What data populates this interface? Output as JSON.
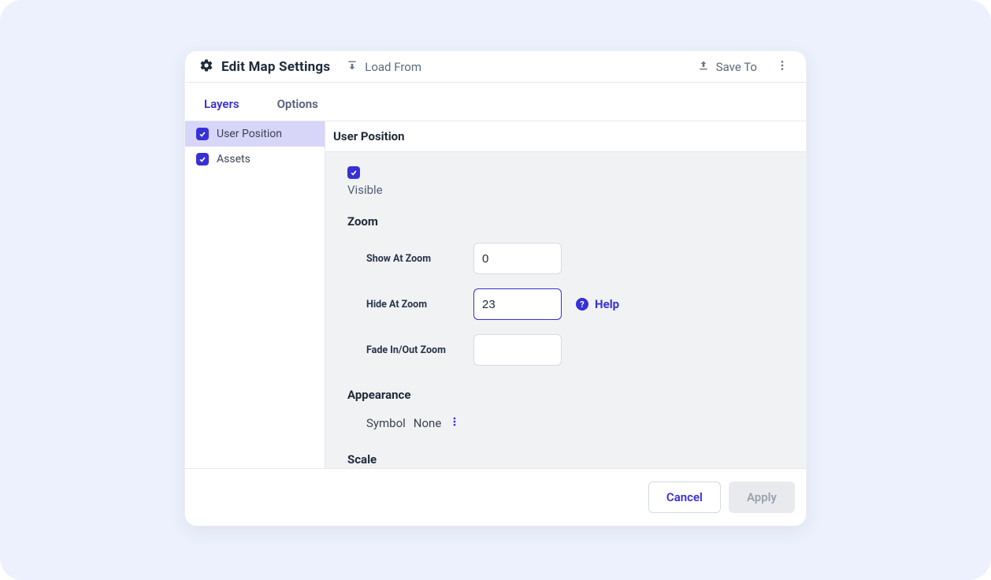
{
  "header": {
    "title": "Edit Map Settings",
    "load_from_label": "Load From",
    "save_to_label": "Save To"
  },
  "tabs": {
    "layers": "Layers",
    "options": "Options",
    "active": "layers"
  },
  "sidebar": {
    "items": [
      {
        "label": "User Position",
        "checked": true,
        "selected": true
      },
      {
        "label": "Assets",
        "checked": true,
        "selected": false
      }
    ]
  },
  "panel": {
    "title": "User Position",
    "visible": {
      "checked": true,
      "label": "Visible"
    },
    "sections": {
      "zoom": {
        "title": "Zoom",
        "fields": {
          "show_at_zoom": {
            "label": "Show At Zoom",
            "value": "0"
          },
          "hide_at_zoom": {
            "label": "Hide At Zoom",
            "value": "23",
            "focused": true
          },
          "fade_zoom": {
            "label": "Fade In/Out Zoom",
            "value": ""
          }
        },
        "help_label": "Help"
      },
      "appearance": {
        "title": "Appearance",
        "symbol_label": "Symbol",
        "symbol_value": "None"
      },
      "scale": {
        "title": "Scale"
      }
    }
  },
  "footer": {
    "cancel_label": "Cancel",
    "apply_label": "Apply"
  },
  "colors": {
    "accent": "#3730d6",
    "stage_bg": "#ecf1fd",
    "panel_bg": "#f1f2f4"
  }
}
